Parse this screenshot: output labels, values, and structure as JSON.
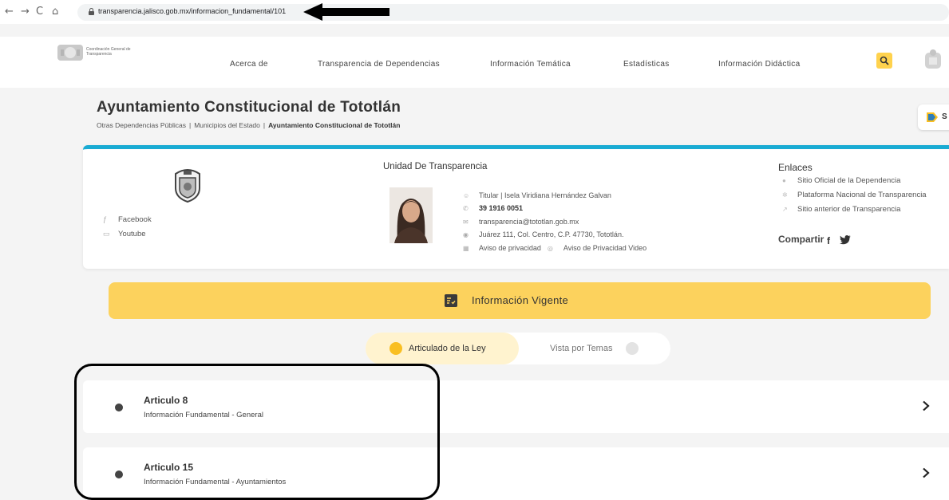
{
  "browser": {
    "back": "←",
    "forward": "→",
    "reload": "C",
    "home": "⌂",
    "url": "transparencia.jalisco.gob.mx/informacion_fundamental/101"
  },
  "header": {
    "logo_text": "Coordinación General de Transparencia",
    "menu": [
      "Acerca de",
      "Transparencia de Dependencias",
      "Información Temática",
      "Estadísticas",
      "Información Didáctica"
    ]
  },
  "page": {
    "title": "Ayuntamiento Constitucional de Tototlán",
    "breadcrumb": [
      "Otras Dependencias Públicas",
      "Municipios del Estado",
      "Ayuntamiento Constitucional de Tototlán"
    ],
    "breadcrumb_sep": "|",
    "side_button_label": "S"
  },
  "card": {
    "social": [
      {
        "icon": "facebook-icon",
        "label": "Facebook"
      },
      {
        "icon": "youtube-icon",
        "label": "Youtube"
      }
    ],
    "unit_title": "Unidad De Transparencia",
    "titular": "Titular | Isela Viridiana Hernández Galvan",
    "phone": "39 1916 0051",
    "email": "transparencia@tototlan.gob.mx",
    "address": "Juárez 111, Col. Centro, C.P. 47730, Tototlán.",
    "aviso": "Aviso de privacidad",
    "aviso_video": "Aviso de Privacidad Video",
    "enlaces_title": "Enlaces",
    "enlaces": [
      "Sitio Oficial de la Dependencia",
      "Plataforma Nacional de Transparencia",
      "Sitio anterior de Transparencia"
    ],
    "compartir": "Compartir",
    "share_fb": "f"
  },
  "banner": {
    "label": "Información Vigente"
  },
  "toggle": {
    "option_a": "Articulado de la Ley",
    "option_b": "Vista por Temas"
  },
  "articles": [
    {
      "title": "Articulo 8",
      "subtitle": "Información Fundamental - General"
    },
    {
      "title": "Articulo 15",
      "subtitle": "Información Fundamental - Ayuntamientos"
    }
  ],
  "colors": {
    "accent_yellow": "#fcd25d",
    "accent_blue": "#19abd3",
    "dot_yellow": "#f9bf22"
  }
}
